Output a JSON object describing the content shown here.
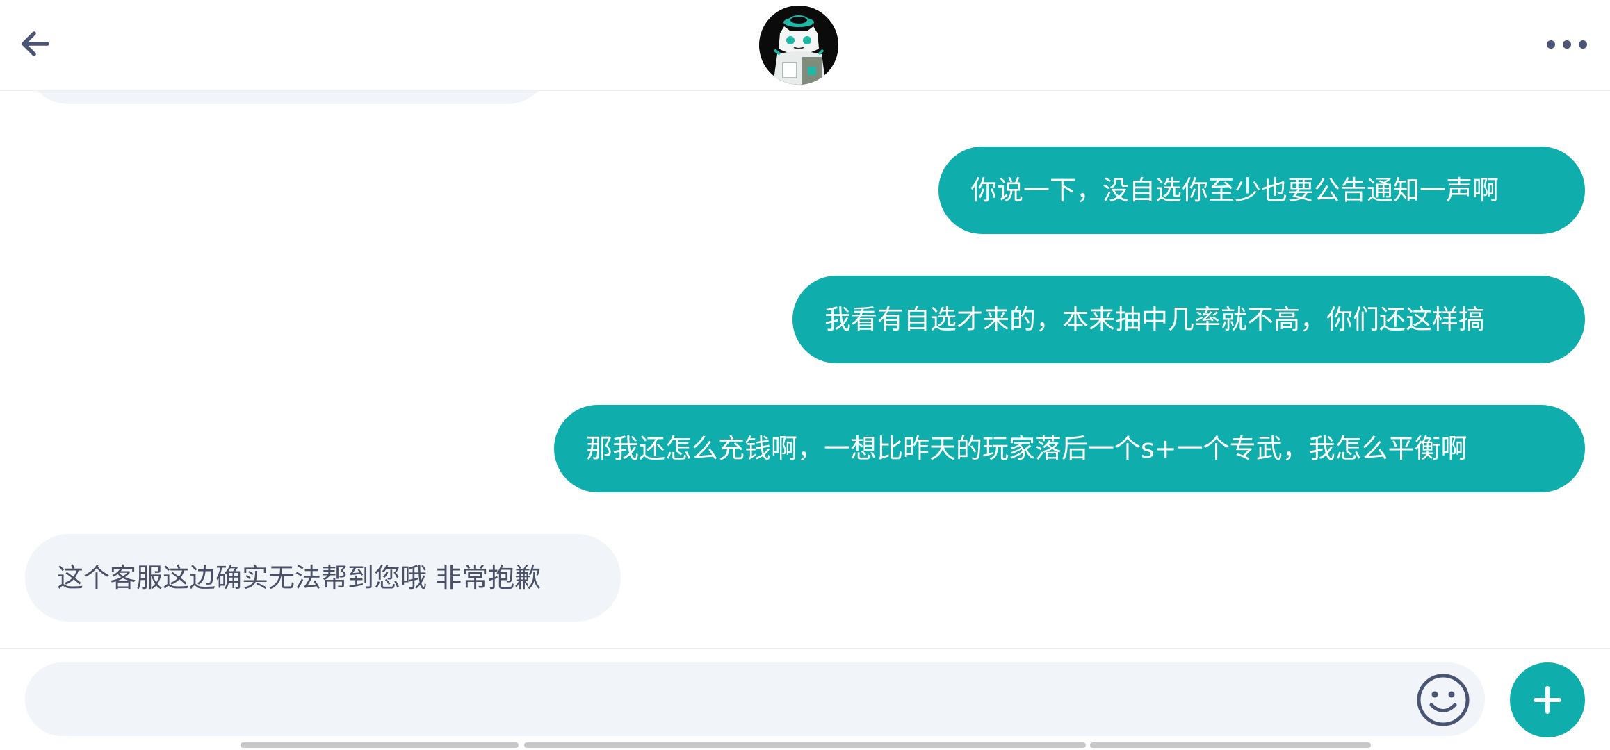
{
  "header": {
    "back_icon": "arrow-left-icon",
    "avatar_icon": "avatar-image",
    "more_icon": "more-horizontal-icon"
  },
  "messages": [
    {
      "direction": "out",
      "text": "你说一下，没自选你至少也要公告通知一声啊"
    },
    {
      "direction": "out",
      "text": "我看有自选才来的，本来抽中几率就不高，你们还这样搞"
    },
    {
      "direction": "out",
      "text": "那我还怎么充钱啊，一想比昨天的玩家落后一个s+一个专武，我怎么平衡啊"
    },
    {
      "direction": "in",
      "text": "这个客服这边确实无法帮到您哦 非常抱歉"
    }
  ],
  "composer": {
    "value": "",
    "placeholder": "",
    "emoji_icon": "smiley-icon",
    "add_icon": "plus-icon"
  },
  "colors": {
    "accent": "#10adad",
    "incoming_bubble": "#f1f4f8",
    "incoming_text": "#4a5068",
    "icon": "#4a5474"
  }
}
